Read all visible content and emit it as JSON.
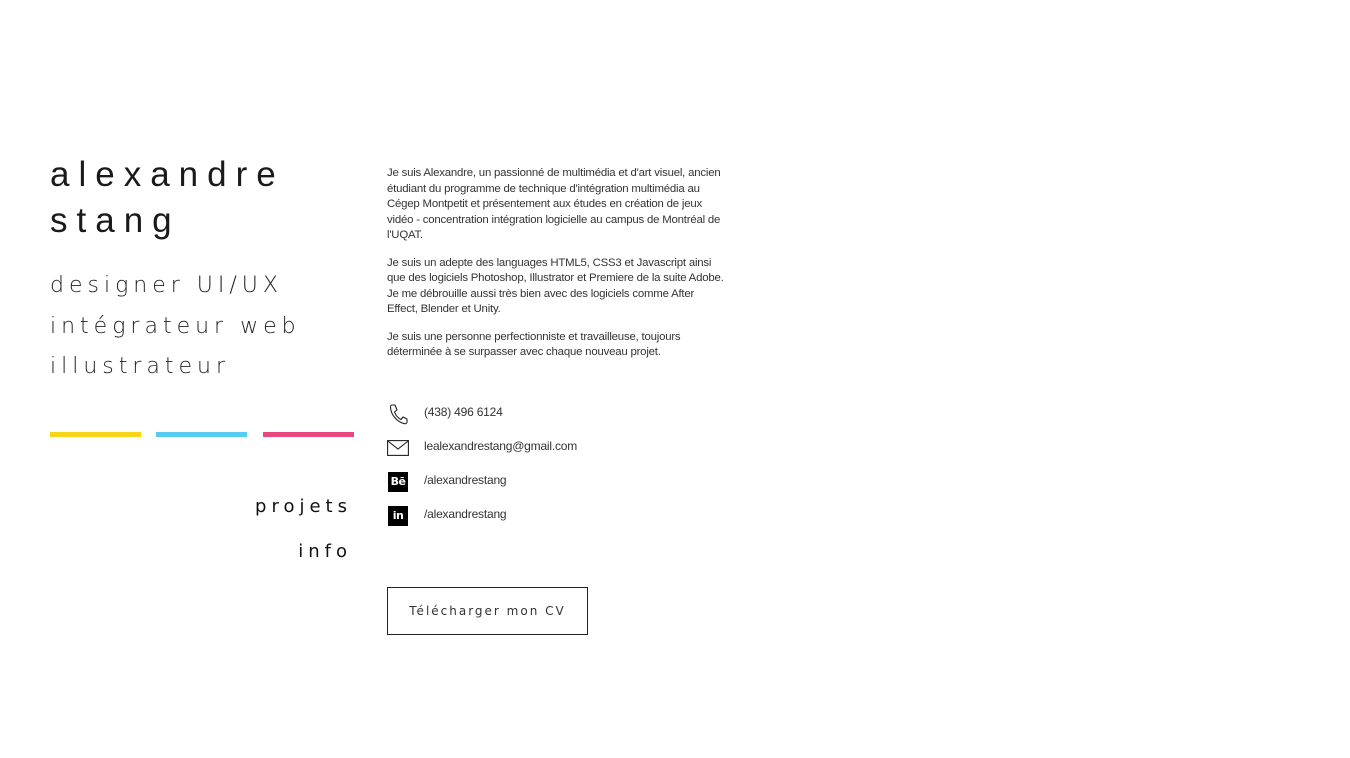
{
  "profile": {
    "first_name": "alexandre",
    "last_name": "stang",
    "roles": [
      "designer UI/UX",
      "intégrateur web",
      "illustrateur"
    ]
  },
  "accent_bars": {
    "yellow": "#f7d417",
    "cyan": "#56ccee",
    "pink": "#e8497c"
  },
  "nav": {
    "projets": "projets",
    "info": "info"
  },
  "bio": {
    "p1": "Je suis Alexandre, un passionné de multimédia et d'art visuel, ancien étudiant du programme de technique d'intégration multimédia au Cégep Montpetit et présentement aux études en création de jeux vidéo - concentration intégration logicielle au campus de Montréal de l'UQAT.",
    "p2": "Je suis un adepte des languages HTML5, CSS3 et Javascript ainsi que des logiciels Photoshop, Illustrator et Premiere de la suite Adobe. Je me débrouille aussi très bien avec des logiciels comme After Effect, Blender et Unity.",
    "p3": "Je suis une personne perfectionniste et travailleuse, toujours déterminée à se surpasser avec chaque nouveau projet."
  },
  "contacts": {
    "phone": "(438) 496 6124",
    "email": "lealexandrestang@gmail.com",
    "behance_badge": "Bē",
    "behance": "/alexandrestang",
    "linkedin_badge": "in",
    "linkedin": "/alexandrestang",
    "icons": [
      "phone-icon",
      "mail-icon",
      "behance-icon",
      "linkedin-icon"
    ]
  },
  "cv_button": {
    "label": "Télécharger mon CV"
  }
}
